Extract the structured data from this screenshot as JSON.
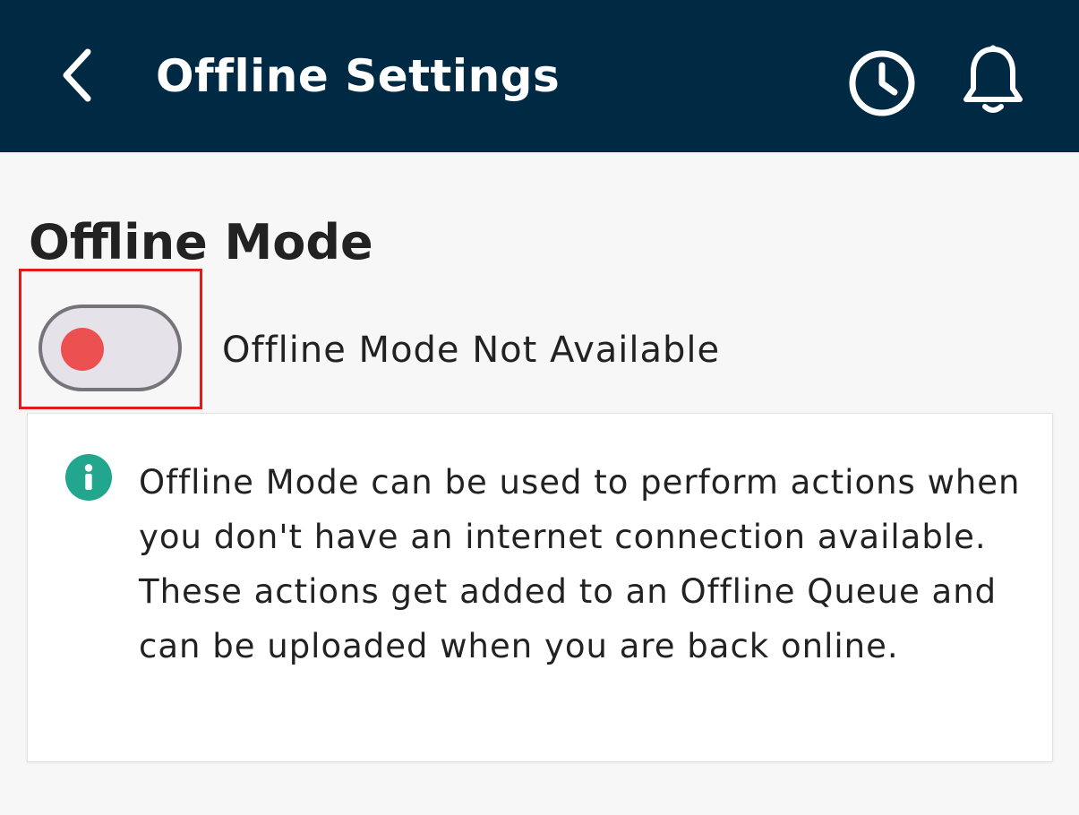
{
  "header": {
    "title": "Offline Settings",
    "background_color": "#002a44",
    "icons": [
      "chevron-left-icon",
      "history-clock-icon",
      "bell-icon"
    ]
  },
  "offline_mode": {
    "title": "Offline Mode",
    "toggle": {
      "state": "off",
      "knob_color": "#ec5050",
      "label": "Offline Mode Not Available"
    },
    "info": {
      "icon": "info-icon",
      "icon_color": "#22a78e",
      "text": "Offline Mode can be used to perform actions when you don't have an internet connection available. These actions get added to an Offline Queue and can be uploaded when you are back online."
    }
  }
}
